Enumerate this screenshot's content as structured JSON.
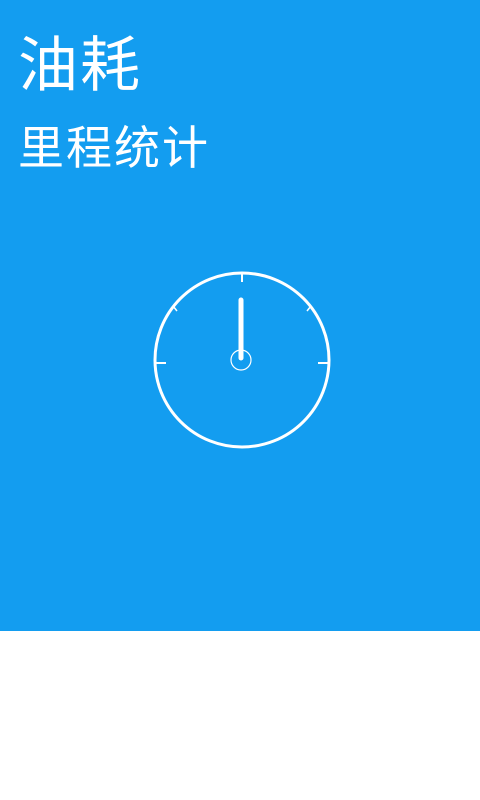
{
  "splash": {
    "title": "油耗",
    "subtitle": "里程统计",
    "background_color": "#139df0",
    "icon": "speedometer-gauge-icon"
  }
}
